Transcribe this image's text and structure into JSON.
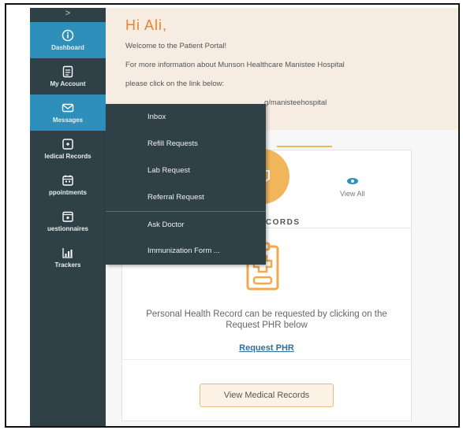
{
  "sidebar": {
    "toggle": ">",
    "items": [
      {
        "label": "Dashboard",
        "icon": "info-icon",
        "active": true
      },
      {
        "label": "My Account",
        "icon": "document-icon",
        "active": false
      },
      {
        "label": "Messages",
        "icon": "envelope-icon",
        "active": true
      },
      {
        "label": "ledical Records",
        "icon": "record-icon",
        "active": false
      },
      {
        "label": "ppointments",
        "icon": "calendar-icon",
        "active": false
      },
      {
        "label": "uestionnaires",
        "icon": "clipboard-icon",
        "active": false
      },
      {
        "label": "Trackers",
        "icon": "chart-icon",
        "active": false
      }
    ]
  },
  "welcome": {
    "greeting": "Hi Ali,",
    "line1": "Welcome to the Patient Portal!",
    "line2": "For more information about Munson Healthcare Manistee Hospital",
    "line3": "please click on the link below:",
    "link": "g/manisteehospital"
  },
  "messages_menu": {
    "items": [
      "Inbox",
      "Refill Requests",
      "Lab Request",
      "Referral Request",
      "Ask Doctor",
      "Immunization Form ..."
    ]
  },
  "records_card": {
    "title": "RECORDS",
    "view_all": "View All",
    "phr_text": "Personal Health Record can be requested by clicking on the Request PHR below",
    "request_phr": "Request PHR",
    "view_button": "View Medical Records"
  },
  "colors": {
    "sidebar_bg": "#2f4147",
    "active_bg": "#2e8fba",
    "accent": "#e8842a",
    "record_circle": "#f1b55a"
  }
}
